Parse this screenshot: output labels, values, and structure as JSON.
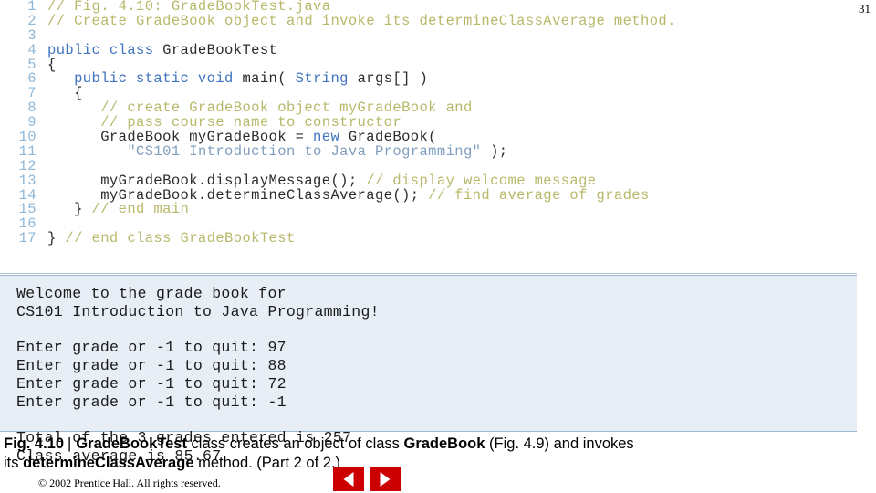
{
  "slide": {
    "number": "31",
    "copyright": "© 2002 Prentice Hall. All rights reserved."
  },
  "code": {
    "lines": [
      {
        "num": "1",
        "segments": [
          {
            "t": "// Fig. 4.10: GradeBookTest.java",
            "c": "cmt"
          }
        ]
      },
      {
        "num": "2",
        "segments": [
          {
            "t": "// Create GradeBook object and invoke its determineClassAverage method.",
            "c": "cmt"
          }
        ]
      },
      {
        "num": "3",
        "segments": [
          {
            "t": "",
            "c": "txt"
          }
        ]
      },
      {
        "num": "4",
        "segments": [
          {
            "t": "public class ",
            "c": "kw"
          },
          {
            "t": "GradeBookTest",
            "c": "txt"
          }
        ]
      },
      {
        "num": "5",
        "segments": [
          {
            "t": "{",
            "c": "txt"
          }
        ]
      },
      {
        "num": "6",
        "segments": [
          {
            "t": "   ",
            "c": "txt"
          },
          {
            "t": "public static void ",
            "c": "kw"
          },
          {
            "t": "main( ",
            "c": "txt"
          },
          {
            "t": "String ",
            "c": "kw"
          },
          {
            "t": "args[] )",
            "c": "txt"
          }
        ]
      },
      {
        "num": "7",
        "segments": [
          {
            "t": "   {",
            "c": "txt"
          }
        ]
      },
      {
        "num": "8",
        "segments": [
          {
            "t": "      ",
            "c": "txt"
          },
          {
            "t": "// create GradeBook object myGradeBook and",
            "c": "cmt"
          }
        ]
      },
      {
        "num": "9",
        "segments": [
          {
            "t": "      ",
            "c": "txt"
          },
          {
            "t": "// pass course name to constructor",
            "c": "cmt"
          }
        ]
      },
      {
        "num": "10",
        "segments": [
          {
            "t": "      GradeBook myGradeBook = ",
            "c": "txt"
          },
          {
            "t": "new ",
            "c": "kw"
          },
          {
            "t": "GradeBook(",
            "c": "txt"
          }
        ]
      },
      {
        "num": "11",
        "segments": [
          {
            "t": "         ",
            "c": "txt"
          },
          {
            "t": "\"CS101 Introduction to Java Programming\"",
            "c": "str"
          },
          {
            "t": " );",
            "c": "txt"
          }
        ]
      },
      {
        "num": "12",
        "segments": [
          {
            "t": "",
            "c": "txt"
          }
        ]
      },
      {
        "num": "13",
        "segments": [
          {
            "t": "      myGradeBook.displayMessage(); ",
            "c": "txt"
          },
          {
            "t": "// display welcome message",
            "c": "cmt"
          }
        ]
      },
      {
        "num": "14",
        "segments": [
          {
            "t": "      myGradeBook.determineClassAverage(); ",
            "c": "txt"
          },
          {
            "t": "// find average of grades",
            "c": "cmt"
          }
        ]
      },
      {
        "num": "15",
        "segments": [
          {
            "t": "   } ",
            "c": "txt"
          },
          {
            "t": "// end main",
            "c": "cmt"
          }
        ]
      },
      {
        "num": "16",
        "segments": [
          {
            "t": "",
            "c": "txt"
          }
        ]
      },
      {
        "num": "17",
        "segments": [
          {
            "t": "} ",
            "c": "txt"
          },
          {
            "t": "// end class GradeBookTest",
            "c": "cmt"
          }
        ]
      }
    ]
  },
  "console": {
    "lines": [
      "Welcome to the grade book for",
      "CS101 Introduction to Java Programming!",
      "",
      "Enter grade or -1 to quit: 97",
      "Enter grade or -1 to quit: 88",
      "Enter grade or -1 to quit: 72",
      "Enter grade or -1 to quit: -1",
      "",
      "Total of the 3 grades entered is 257",
      "Class average is 85.67"
    ]
  },
  "caption": {
    "figure_label": "Fig. 4.10",
    "separator": "|",
    "text_1": "GradeBookTest",
    "text_2": " class creates an object of class ",
    "text_3": "GradeBook",
    "text_4": " (Fig. 4.9) and invokes",
    "text_5": "its ",
    "text_6": "determineClassAverage",
    "text_7": " method. (Part 2 of 2.)"
  },
  "nav": {
    "prev_label": "previous-slide",
    "next_label": "next-slide",
    "accent_color": "#cc0000"
  }
}
